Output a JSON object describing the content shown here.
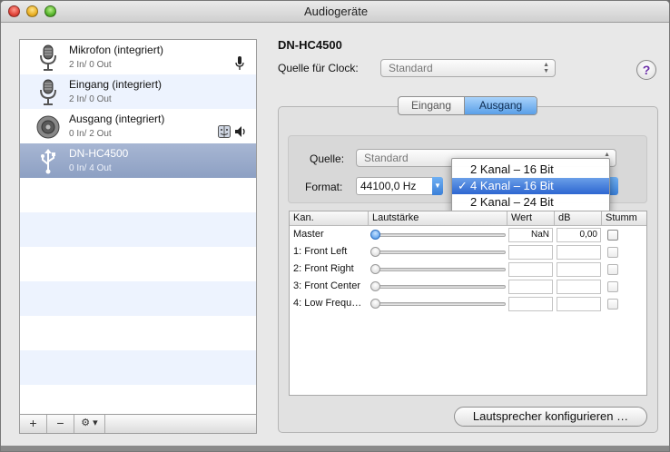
{
  "window": {
    "title": "Audiogeräte"
  },
  "devices": [
    {
      "name": "Mikrofon (integriert)",
      "channels": "2 In/ 0 Out",
      "icon": "microphone-icon"
    },
    {
      "name": "Eingang (integriert)",
      "channels": "2 In/ 0 Out",
      "icon": "microphone-icon"
    },
    {
      "name": "Ausgang (integriert)",
      "channels": "0 In/ 2 Out",
      "icon": "speaker-icon"
    },
    {
      "name": "DN-HC4500",
      "channels": "0 In/ 4 Out",
      "icon": "usb-icon",
      "selected": true
    }
  ],
  "list_toolbar": {
    "add": "+",
    "remove": "−",
    "action": "⚙ ▾"
  },
  "detail": {
    "device_title": "DN-HC4500",
    "clock_label": "Quelle für Clock:",
    "clock_value": "Standard",
    "help": "?",
    "tabs": [
      "Eingang",
      "Ausgang"
    ],
    "active_tab": "Ausgang",
    "source_label": "Quelle:",
    "source_value": "Standard",
    "format_label": "Format:",
    "format_value": "44100,0 Hz",
    "format_menu": [
      {
        "label": "2 Kanal – 16 Bit",
        "checked": false
      },
      {
        "label": "4 Kanal – 16 Bit",
        "checked": true
      },
      {
        "label": "2 Kanal – 24 Bit",
        "checked": false
      }
    ],
    "table_headers": [
      "Kan.",
      "Lautstärke",
      "Wert",
      "dB",
      "Stumm"
    ],
    "channels": [
      {
        "name": "Master",
        "wert": "NaN",
        "db": "0,00",
        "active": true
      },
      {
        "name": "1: Front Left",
        "wert": "",
        "db": "",
        "active": false
      },
      {
        "name": "2: Front Right",
        "wert": "",
        "db": "",
        "active": false
      },
      {
        "name": "3: Front Center",
        "wert": "",
        "db": "",
        "active": false
      },
      {
        "name": "4: Low Frequ…",
        "wert": "",
        "db": "",
        "active": false
      }
    ],
    "configure_button": "Lautsprecher konfigurieren …"
  },
  "colors": {
    "selection": "#8da0c3",
    "accent": "#3a7fd8",
    "alt_row": "#edf3fe"
  }
}
